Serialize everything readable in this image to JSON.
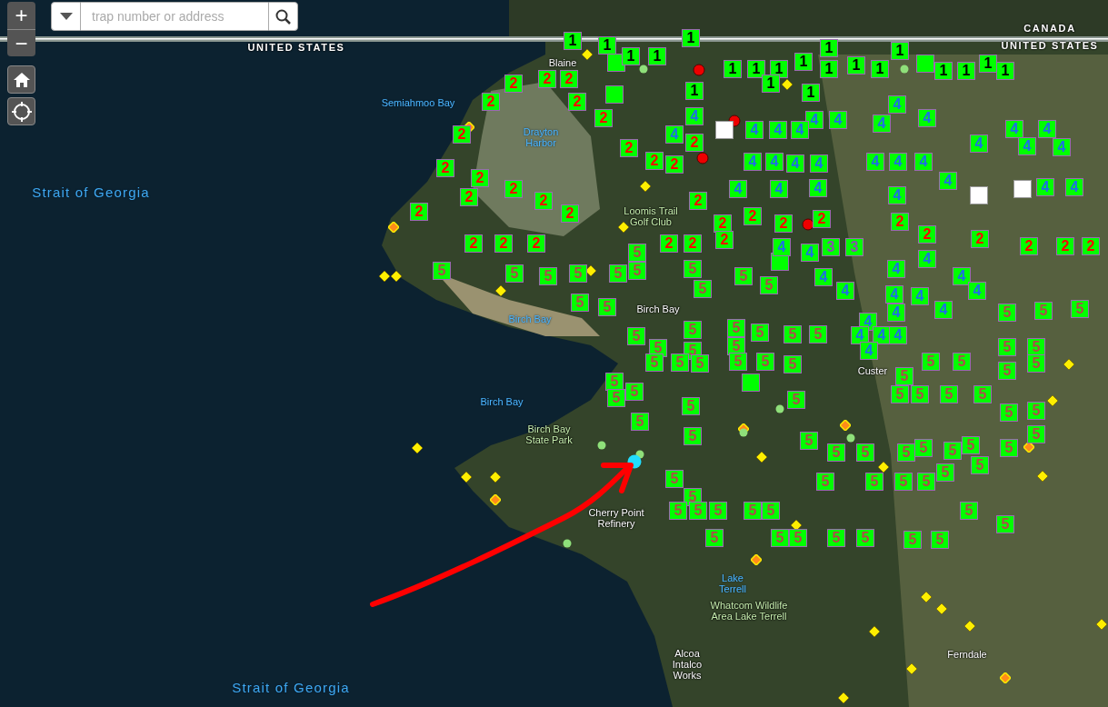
{
  "zoom_controls": [
    {
      "kind": "in",
      "label": "+"
    },
    {
      "kind": "out",
      "label": "−"
    }
  ],
  "search": {
    "placeholder": "trap number or address"
  },
  "map_labels": [
    {
      "text": "UNITED STATES",
      "kind": "border"
    },
    {
      "text": "CANADA",
      "kind": "border"
    },
    {
      "text": "UNITED STATES",
      "kind": "border"
    },
    {
      "text": "Blaine",
      "kind": "place"
    },
    {
      "text": "Semiahmoo Bay",
      "kind": "water"
    },
    {
      "text": "Drayton Harbor",
      "kind": "water"
    },
    {
      "text": "Strait of Georgia",
      "kind": "sea"
    },
    {
      "text": "Loomis Trail Golf Club",
      "kind": "park"
    },
    {
      "text": "Birch Bay",
      "kind": "water"
    },
    {
      "text": "Birch Bay",
      "kind": "place"
    },
    {
      "text": "Birch Bay",
      "kind": "water"
    },
    {
      "text": "Birch Bay State Park",
      "kind": "park"
    },
    {
      "text": "Custer",
      "kind": "place"
    },
    {
      "text": "Cherry Point Refinery",
      "kind": "place"
    },
    {
      "text": "Lake Terrell",
      "kind": "water"
    },
    {
      "text": "Whatcom Wildlife Area Lake Terrell",
      "kind": "park"
    },
    {
      "text": "Alcoa Intalco Works",
      "kind": "place"
    },
    {
      "text": "Ferndale",
      "kind": "place"
    },
    {
      "text": "Strait of Georgia",
      "kind": "sea"
    }
  ],
  "markers": [
    {
      "label": "1",
      "kind": "zone1"
    },
    {
      "label": "1",
      "kind": "zone1"
    },
    {
      "label": "1",
      "kind": "zone1"
    },
    {
      "label": "1",
      "kind": "zone1"
    },
    {
      "label": "1",
      "kind": "zone1"
    },
    {
      "label": "1",
      "kind": "zone1"
    },
    {
      "label": "1",
      "kind": "zone1"
    },
    {
      "label": "1",
      "kind": "zone1"
    },
    {
      "label": "1",
      "kind": "zone1"
    },
    {
      "label": "1",
      "kind": "zone1"
    },
    {
      "label": "1",
      "kind": "zone1"
    },
    {
      "label": "1",
      "kind": "zone1"
    },
    {
      "label": "1",
      "kind": "zone1"
    },
    {
      "label": "1",
      "kind": "zone1"
    },
    {
      "label": "1",
      "kind": "zone1"
    },
    {
      "label": "1",
      "kind": "zone1"
    },
    {
      "label": "1",
      "kind": "zone1"
    },
    {
      "label": "1",
      "kind": "zone1"
    },
    {
      "label": "1",
      "kind": "zone1"
    },
    {
      "label": "1",
      "kind": "zone1"
    },
    {
      "label": "1",
      "kind": "zone1"
    },
    {
      "label": "2",
      "kind": "zone2"
    },
    {
      "label": "2",
      "kind": "zone2"
    },
    {
      "label": "2",
      "kind": "zone2"
    },
    {
      "label": "2",
      "kind": "zone2"
    },
    {
      "label": "2",
      "kind": "zone2"
    },
    {
      "label": "2",
      "kind": "zone2"
    },
    {
      "label": "2",
      "kind": "zone2"
    },
    {
      "label": "2",
      "kind": "zone2"
    },
    {
      "label": "2",
      "kind": "zone2"
    },
    {
      "label": "2",
      "kind": "zone2"
    },
    {
      "label": "2",
      "kind": "zone2"
    },
    {
      "label": "2",
      "kind": "zone2"
    },
    {
      "label": "2",
      "kind": "zone2"
    },
    {
      "label": "2",
      "kind": "zone2"
    },
    {
      "label": "2",
      "kind": "zone2"
    },
    {
      "label": "2",
      "kind": "zone2"
    },
    {
      "label": "2",
      "kind": "zone2"
    },
    {
      "label": "2",
      "kind": "zone2"
    },
    {
      "label": "2",
      "kind": "zone2"
    },
    {
      "label": "2",
      "kind": "zone2"
    },
    {
      "label": "2",
      "kind": "zone2"
    },
    {
      "label": "2",
      "kind": "zone2"
    },
    {
      "label": "2",
      "kind": "zone2"
    },
    {
      "label": "2",
      "kind": "zone2"
    },
    {
      "label": "2",
      "kind": "zone2"
    },
    {
      "label": "2",
      "kind": "zone2"
    },
    {
      "label": "2",
      "kind": "zone2"
    },
    {
      "label": "2",
      "kind": "zone2"
    },
    {
      "label": "2",
      "kind": "zone2"
    },
    {
      "label": "2",
      "kind": "zone2"
    },
    {
      "label": "2",
      "kind": "zone2"
    },
    {
      "label": "2",
      "kind": "zone2"
    },
    {
      "label": "3",
      "kind": "zone3"
    },
    {
      "label": "3",
      "kind": "zone3"
    },
    {
      "label": "2",
      "kind": "zone2"
    },
    {
      "label": "2",
      "kind": "zone2"
    },
    {
      "label": "2",
      "kind": "zone2"
    },
    {
      "label": "4",
      "kind": "zone4"
    },
    {
      "label": "4",
      "kind": "zone4"
    },
    {
      "label": "4",
      "kind": "zone4"
    },
    {
      "label": "4",
      "kind": "zone4"
    },
    {
      "label": "4",
      "kind": "zone4"
    },
    {
      "label": "4",
      "kind": "zone4"
    },
    {
      "label": "4",
      "kind": "zone4"
    },
    {
      "label": "4",
      "kind": "zone4"
    },
    {
      "label": "4",
      "kind": "zone4"
    },
    {
      "label": "4",
      "kind": "zone4"
    },
    {
      "label": "4",
      "kind": "zone4"
    },
    {
      "label": "4",
      "kind": "zone4"
    },
    {
      "label": "4",
      "kind": "zone4"
    },
    {
      "label": "4",
      "kind": "zone4"
    },
    {
      "label": "4",
      "kind": "zone4"
    },
    {
      "label": "4",
      "kind": "zone4"
    },
    {
      "label": "4",
      "kind": "zone4"
    },
    {
      "label": "4",
      "kind": "zone4"
    },
    {
      "label": "4",
      "kind": "zone4"
    },
    {
      "label": "4",
      "kind": "zone4"
    },
    {
      "label": "4",
      "kind": "zone4"
    },
    {
      "label": "4",
      "kind": "zone4"
    },
    {
      "label": "4",
      "kind": "zone4"
    },
    {
      "label": "4",
      "kind": "zone4"
    },
    {
      "label": "4",
      "kind": "zone4"
    },
    {
      "label": "4",
      "kind": "zone4"
    },
    {
      "label": "4",
      "kind": "zone4"
    },
    {
      "label": "4",
      "kind": "zone4"
    },
    {
      "label": "4",
      "kind": "zone4"
    },
    {
      "label": "4",
      "kind": "zone4"
    },
    {
      "label": "4",
      "kind": "zone4"
    },
    {
      "label": "4",
      "kind": "zone4"
    },
    {
      "label": "4",
      "kind": "zone4"
    },
    {
      "label": "4",
      "kind": "zone4"
    },
    {
      "label": "4",
      "kind": "zone4"
    },
    {
      "label": "4",
      "kind": "zone4"
    },
    {
      "label": "4",
      "kind": "zone4"
    },
    {
      "label": "4",
      "kind": "zone4"
    },
    {
      "label": "4",
      "kind": "zone4"
    },
    {
      "label": "4",
      "kind": "zone4"
    },
    {
      "label": "4",
      "kind": "zone4"
    },
    {
      "label": "4",
      "kind": "zone4"
    },
    {
      "label": "4",
      "kind": "zone4"
    },
    {
      "label": "4",
      "kind": "zone4"
    },
    {
      "label": "4",
      "kind": "zone4"
    },
    {
      "label": "4",
      "kind": "zone4"
    },
    {
      "label": "5",
      "kind": "zone5"
    },
    {
      "label": "5",
      "kind": "zone5"
    },
    {
      "label": "5",
      "kind": "zone5"
    },
    {
      "label": "5",
      "kind": "zone5"
    },
    {
      "label": "5",
      "kind": "zone5"
    },
    {
      "label": "5",
      "kind": "zone5"
    },
    {
      "label": "5",
      "kind": "zone5"
    },
    {
      "label": "5",
      "kind": "zone5"
    },
    {
      "label": "5",
      "kind": "zone5"
    },
    {
      "label": "5",
      "kind": "zone5"
    },
    {
      "label": "5",
      "kind": "zone5"
    },
    {
      "label": "5",
      "kind": "zone5"
    },
    {
      "label": "5",
      "kind": "zone5"
    },
    {
      "label": "5",
      "kind": "zone5"
    },
    {
      "label": "5",
      "kind": "zone5"
    },
    {
      "label": "5",
      "kind": "zone5"
    },
    {
      "label": "5",
      "kind": "zone5"
    },
    {
      "label": "5",
      "kind": "zone5"
    },
    {
      "label": "5",
      "kind": "zone5"
    },
    {
      "label": "5",
      "kind": "zone5"
    },
    {
      "label": "5",
      "kind": "zone5"
    },
    {
      "label": "5",
      "kind": "zone5"
    },
    {
      "label": "5",
      "kind": "zone5"
    },
    {
      "label": "5",
      "kind": "zone5"
    },
    {
      "label": "5",
      "kind": "zone5"
    },
    {
      "label": "5",
      "kind": "zone5"
    },
    {
      "label": "5",
      "kind": "zone5"
    },
    {
      "label": "5",
      "kind": "zone5"
    },
    {
      "label": "5",
      "kind": "zone5"
    },
    {
      "label": "5",
      "kind": "zone5"
    },
    {
      "label": "5",
      "kind": "zone5"
    },
    {
      "label": "5",
      "kind": "zone5"
    },
    {
      "label": "5",
      "kind": "zone5"
    },
    {
      "label": "5",
      "kind": "zone5"
    },
    {
      "label": "5",
      "kind": "zone5"
    },
    {
      "label": "5",
      "kind": "zone5"
    },
    {
      "label": "5",
      "kind": "zone5"
    },
    {
      "label": "5",
      "kind": "zone5"
    },
    {
      "label": "5",
      "kind": "zone5"
    },
    {
      "label": "5",
      "kind": "zone5"
    },
    {
      "label": "5",
      "kind": "zone5"
    },
    {
      "label": "5",
      "kind": "zone5"
    },
    {
      "label": "5",
      "kind": "zone5"
    },
    {
      "label": "5",
      "kind": "zone5"
    },
    {
      "label": "5",
      "kind": "zone5"
    },
    {
      "label": "5",
      "kind": "zone5"
    },
    {
      "label": "5",
      "kind": "zone5"
    },
    {
      "label": "5",
      "kind": "zone5"
    },
    {
      "label": "5",
      "kind": "zone5"
    },
    {
      "label": "5",
      "kind": "zone5"
    },
    {
      "label": "5",
      "kind": "zone5"
    },
    {
      "label": "5",
      "kind": "zone5"
    },
    {
      "label": "5",
      "kind": "zone5"
    },
    {
      "label": "5",
      "kind": "zone5"
    },
    {
      "label": "5",
      "kind": "zone5"
    },
    {
      "label": "5",
      "kind": "zone5"
    },
    {
      "label": "5",
      "kind": "zone5"
    },
    {
      "label": "5",
      "kind": "zone5"
    },
    {
      "label": "5",
      "kind": "zone5"
    },
    {
      "label": "5",
      "kind": "zone5"
    },
    {
      "label": "5",
      "kind": "zone5"
    },
    {
      "label": "5",
      "kind": "zone5"
    },
    {
      "label": "5",
      "kind": "zone5"
    },
    {
      "label": "5",
      "kind": "zone5"
    },
    {
      "label": "5",
      "kind": "zone5"
    },
    {
      "label": "5",
      "kind": "zone5"
    },
    {
      "label": "5",
      "kind": "zone5"
    },
    {
      "label": "5",
      "kind": "zone5"
    },
    {
      "label": "5",
      "kind": "zone5"
    },
    {
      "label": "5",
      "kind": "zone5"
    },
    {
      "label": "5",
      "kind": "zone5"
    },
    {
      "label": "5",
      "kind": "zone5"
    },
    {
      "label": "5",
      "kind": "zone5"
    },
    {
      "label": "5",
      "kind": "zone5"
    },
    {
      "label": "5",
      "kind": "zone5"
    },
    {
      "label": "5",
      "kind": "zone5"
    },
    {
      "label": "5",
      "kind": "zone5"
    },
    {
      "label": "5",
      "kind": "zone5"
    },
    {
      "label": "5",
      "kind": "zone5"
    },
    {
      "label": "5",
      "kind": "zone5"
    },
    {
      "label": "5",
      "kind": "zone5"
    },
    {
      "label": "5",
      "kind": "zone5"
    }
  ]
}
